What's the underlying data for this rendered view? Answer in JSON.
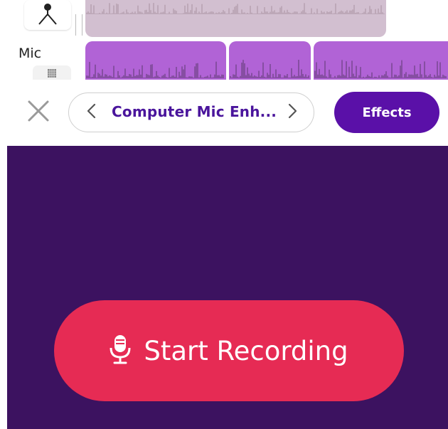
{
  "tracks": {
    "mic_label": "Mic"
  },
  "toolbar": {
    "preset_name": "Computer Mic Enh...",
    "effects_label": "Effects"
  },
  "record": {
    "label": "Start Recording"
  },
  "icons": {
    "camera_track": "tripod-icon",
    "mic_track": "grid-icon",
    "close": "close-icon",
    "prev": "chevron-left-icon",
    "next": "chevron-right-icon",
    "record": "microphone-icon"
  },
  "colors": {
    "accent_purple": "#5a10a8",
    "record_red": "#e62b54",
    "panel_bg": "#3c1260",
    "clip_purple": "#b163d6",
    "lane_mauve": "#d2bfd0"
  }
}
